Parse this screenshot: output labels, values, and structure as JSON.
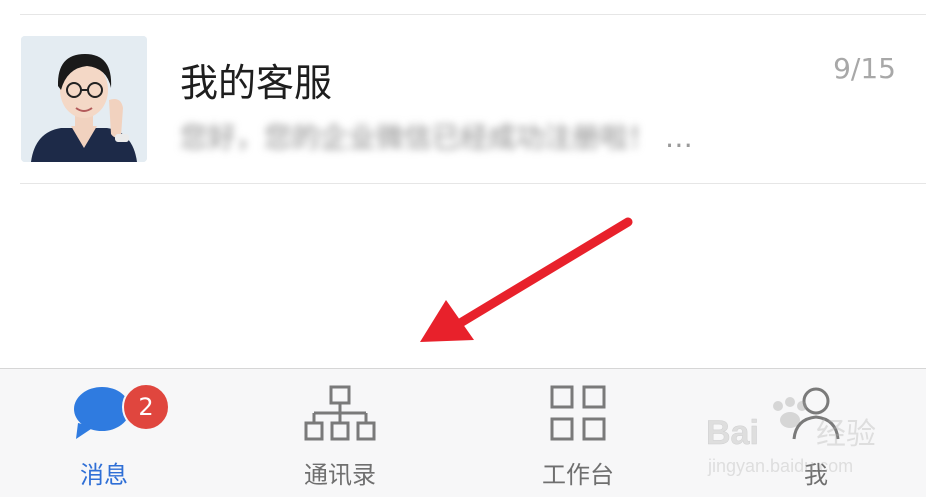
{
  "chat_list": {
    "items": [
      {
        "name": "我的客服",
        "time": "9/15",
        "preview": "您好，您的企业微信已经成功注册啦！",
        "preview_suffix": "…"
      }
    ]
  },
  "tabbar": {
    "tabs": [
      {
        "label": "消息",
        "icon": "chat-bubble-icon",
        "active": true,
        "badge": "2"
      },
      {
        "label": "通讯录",
        "icon": "org-chart-icon"
      },
      {
        "label": "工作台",
        "icon": "grid-icon"
      },
      {
        "label": "我",
        "icon": "person-icon"
      }
    ]
  },
  "watermark": {
    "text": "Bai 经验",
    "subtext": "jingyan.baidu.com"
  },
  "colors": {
    "accent": "#2f6fd6",
    "badge": "#e0463e",
    "arrow": "#e8212b"
  }
}
